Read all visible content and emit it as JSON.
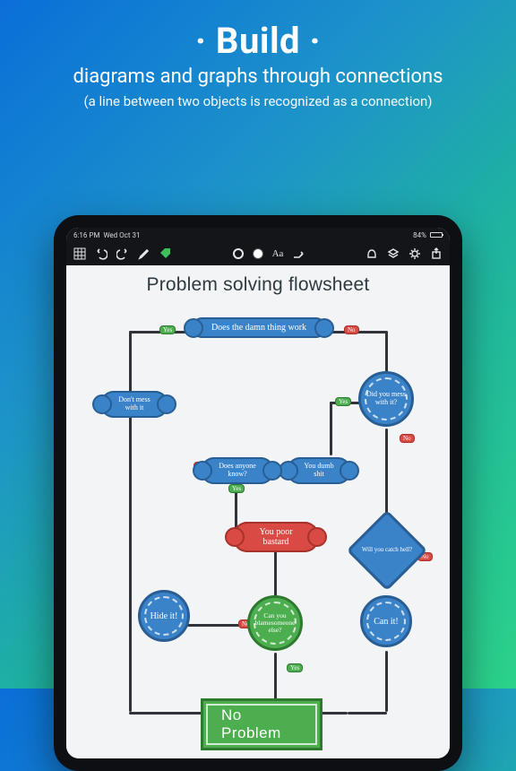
{
  "hero": {
    "title": "· Build ·",
    "subtitle": "diagrams and graphs through connections",
    "note": "(a line between two objects is recognized as a connection)"
  },
  "status": {
    "time": "6:16 PM",
    "date": "Wed Oct 31",
    "battery": "84%"
  },
  "toolbar": {
    "aa": "Aa"
  },
  "canvas": {
    "title": "Problem solving flowsheet"
  },
  "nodes": {
    "n1": "Does the damn thing work",
    "n2": "Don't mess with it",
    "n3": "Did you mess with it?",
    "n4": "You dumb shit",
    "n5": "Does anyone know?",
    "n6": "You poor bastard",
    "n7": "Hide it!",
    "n8": "Can you blamesomeone else?",
    "n9": "Will you catch hell?",
    "n10": "Can it!",
    "n11": "No Problem"
  },
  "labels": {
    "yes": "Yes",
    "no": "No"
  }
}
